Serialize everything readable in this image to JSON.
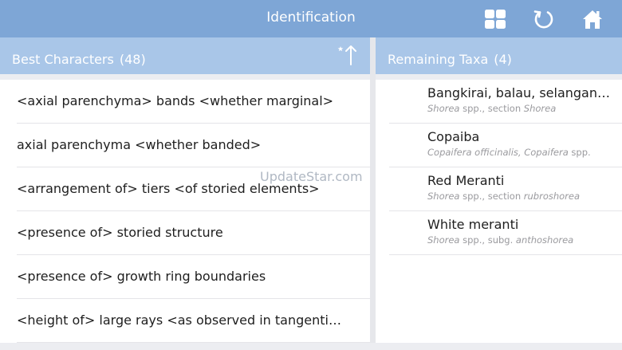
{
  "header": {
    "title": "Identification",
    "icons": [
      "grid-icon",
      "restart-icon",
      "home-icon"
    ]
  },
  "best_characters": {
    "title": "Best Characters",
    "count": "(48)",
    "sort_icon": "sort-icon",
    "items": [
      "<axial parenchyma> bands <whether marginal>",
      "axial parenchyma <whether banded>",
      "<arrangement of> tiers <of storied elements>",
      "<presence of> storied structure",
      "<presence of> growth ring boundaries",
      "<height of> large rays <as observed in tangential section>"
    ]
  },
  "remaining_taxa": {
    "title": "Remaining Taxa",
    "count": "(4)",
    "items": [
      {
        "name": "Bangkirai, balau, selangan batu",
        "sci": [
          "Shorea",
          " spp., section ",
          "Shorea"
        ]
      },
      {
        "name": "Copaiba",
        "sci": [
          "Copaifera officinalis, Copaifera",
          " spp.",
          ""
        ]
      },
      {
        "name": "Red Meranti",
        "sci": [
          "Shorea",
          " spp., section ",
          "rubroshorea"
        ]
      },
      {
        "name": "White meranti",
        "sci": [
          "Shorea",
          " spp., subg. ",
          "anthoshorea"
        ]
      }
    ]
  },
  "watermark": "UpdateStar.com",
  "colors": {
    "top_bar": "#7ea6d6",
    "panel_header": "#a9c6e8"
  }
}
